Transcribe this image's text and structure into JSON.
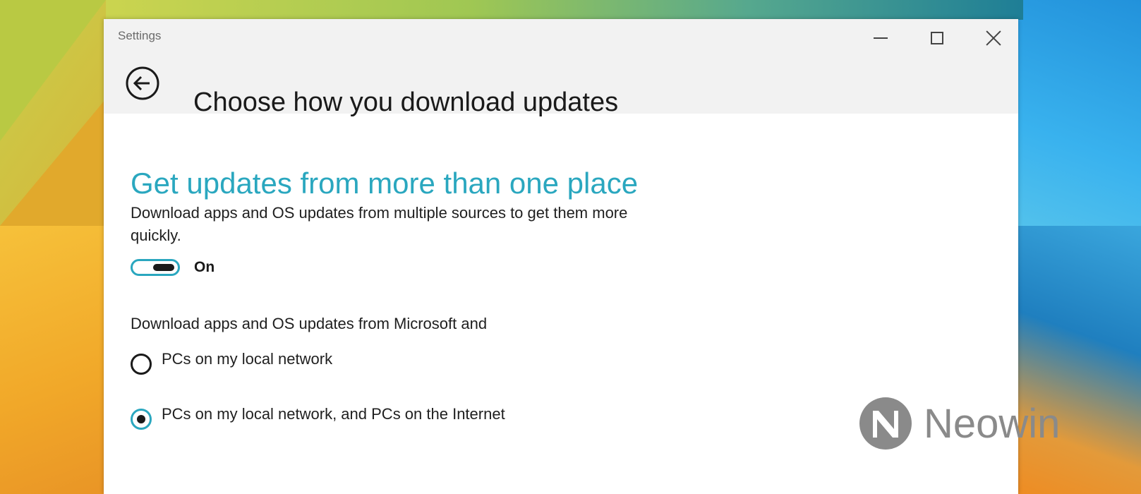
{
  "window": {
    "app_title": "Settings",
    "controls": {
      "minimize_icon": "minimize-icon",
      "maximize_icon": "maximize-icon",
      "close_icon": "close-icon"
    }
  },
  "header": {
    "back_icon": "back-arrow-icon",
    "title": "Choose how you download updates"
  },
  "main": {
    "section_heading": "Get updates from more than one place",
    "description": "Download apps and OS updates from multiple sources to get them more quickly.",
    "toggle": {
      "state_label": "On",
      "on": true
    },
    "source_label": "Download apps and OS updates from Microsoft and",
    "options": [
      {
        "label": "PCs on my local network",
        "selected": false
      },
      {
        "label": "PCs on my local network, and PCs on the Internet",
        "selected": true
      }
    ]
  },
  "watermark": {
    "text": "Neowin"
  },
  "colors": {
    "accent": "#2aa7bf",
    "chrome": "#f2f2f2",
    "text": "#1a1a1a"
  }
}
